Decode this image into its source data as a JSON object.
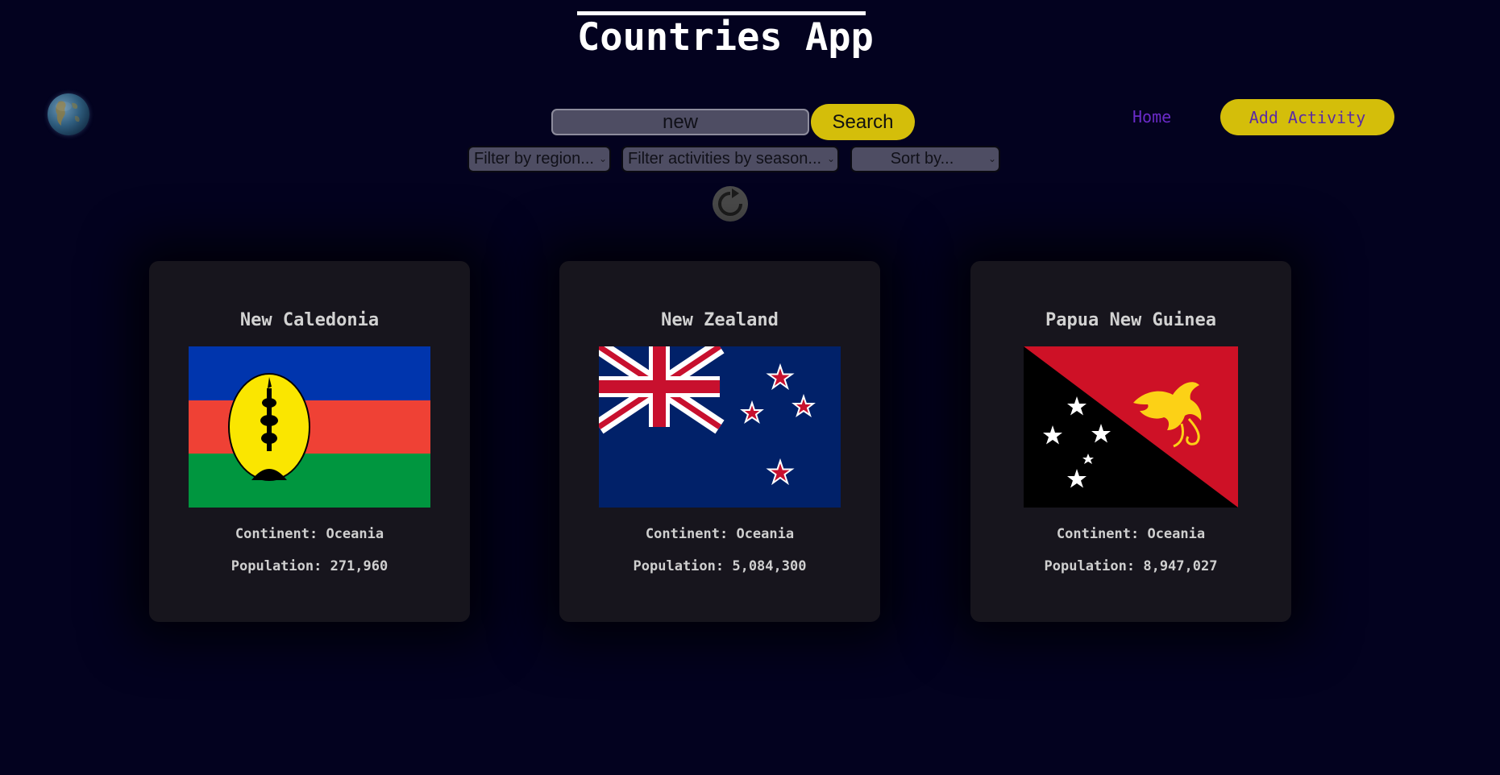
{
  "header": {
    "title": "Countries App"
  },
  "logo": {
    "icon": "globe-icon"
  },
  "search": {
    "value": "new",
    "button_label": "Search"
  },
  "nav": {
    "home_label": "Home",
    "add_activity_label": "Add Activity"
  },
  "filters": {
    "region": "Filter by region...",
    "season": "Filter activities by season...",
    "sort": "Sort by..."
  },
  "refresh": {
    "icon": "refresh-icon"
  },
  "colors": {
    "background": "#03021f",
    "accent": "#d4be0a",
    "link": "#6a2bc8",
    "card": "#17151d"
  },
  "countries": [
    {
      "name": "New Caledonia",
      "flag_icon": "new-caledonia-flag",
      "continent": "Continent: Oceania",
      "population": "Population: 271,960"
    },
    {
      "name": "New Zealand",
      "flag_icon": "new-zealand-flag",
      "continent": "Continent: Oceania",
      "population": "Population: 5,084,300"
    },
    {
      "name": "Papua New Guinea",
      "flag_icon": "papua-new-guinea-flag",
      "continent": "Continent: Oceania",
      "population": "Population: 8,947,027"
    }
  ]
}
